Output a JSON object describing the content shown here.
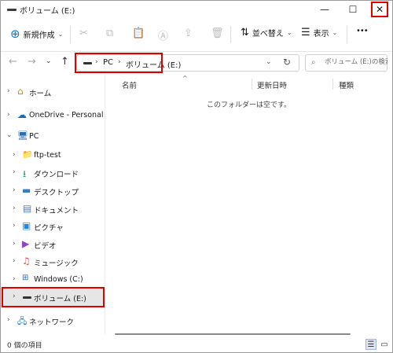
{
  "window": {
    "title": "ボリューム (E:)"
  },
  "titlebar": {
    "minimize": "—",
    "maximize": "☐",
    "close": "✕"
  },
  "toolbar": {
    "new_label": "新規作成",
    "sort_label": "並べ替え",
    "view_label": "表示",
    "more": "•••"
  },
  "address": {
    "segments": [
      "PC",
      "ボリューム (E:)"
    ],
    "search_placeholder": "ボリューム (E:)の検索"
  },
  "sidebar": {
    "items": [
      {
        "label": "ホーム",
        "icon": "home-icon"
      },
      {
        "label": "OneDrive - Personal",
        "icon": "cloud-icon"
      },
      {
        "label": "PC",
        "icon": "pc-icon"
      },
      {
        "label": "ftp-test",
        "icon": "network-folder-icon"
      },
      {
        "label": "ダウンロード",
        "icon": "download-icon"
      },
      {
        "label": "デスクトップ",
        "icon": "desktop-icon"
      },
      {
        "label": "ドキュメント",
        "icon": "document-icon"
      },
      {
        "label": "ピクチャ",
        "icon": "picture-icon"
      },
      {
        "label": "ビデオ",
        "icon": "video-icon"
      },
      {
        "label": "ミュージック",
        "icon": "music-icon"
      },
      {
        "label": "Windows (C:)",
        "icon": "windows-drive-icon"
      },
      {
        "label": "ボリューム (E:)",
        "icon": "drive-icon"
      },
      {
        "label": "ネットワーク",
        "icon": "network-icon"
      }
    ]
  },
  "main": {
    "columns": [
      "名前",
      "更新日時",
      "種類"
    ],
    "empty_message": "このフォルダーは空です。"
  },
  "status": {
    "text": "0 個の項目"
  },
  "colors": {
    "accent": "#0078d4",
    "highlight_box": "#e00000",
    "selected_bg": "#e6e6e6"
  }
}
